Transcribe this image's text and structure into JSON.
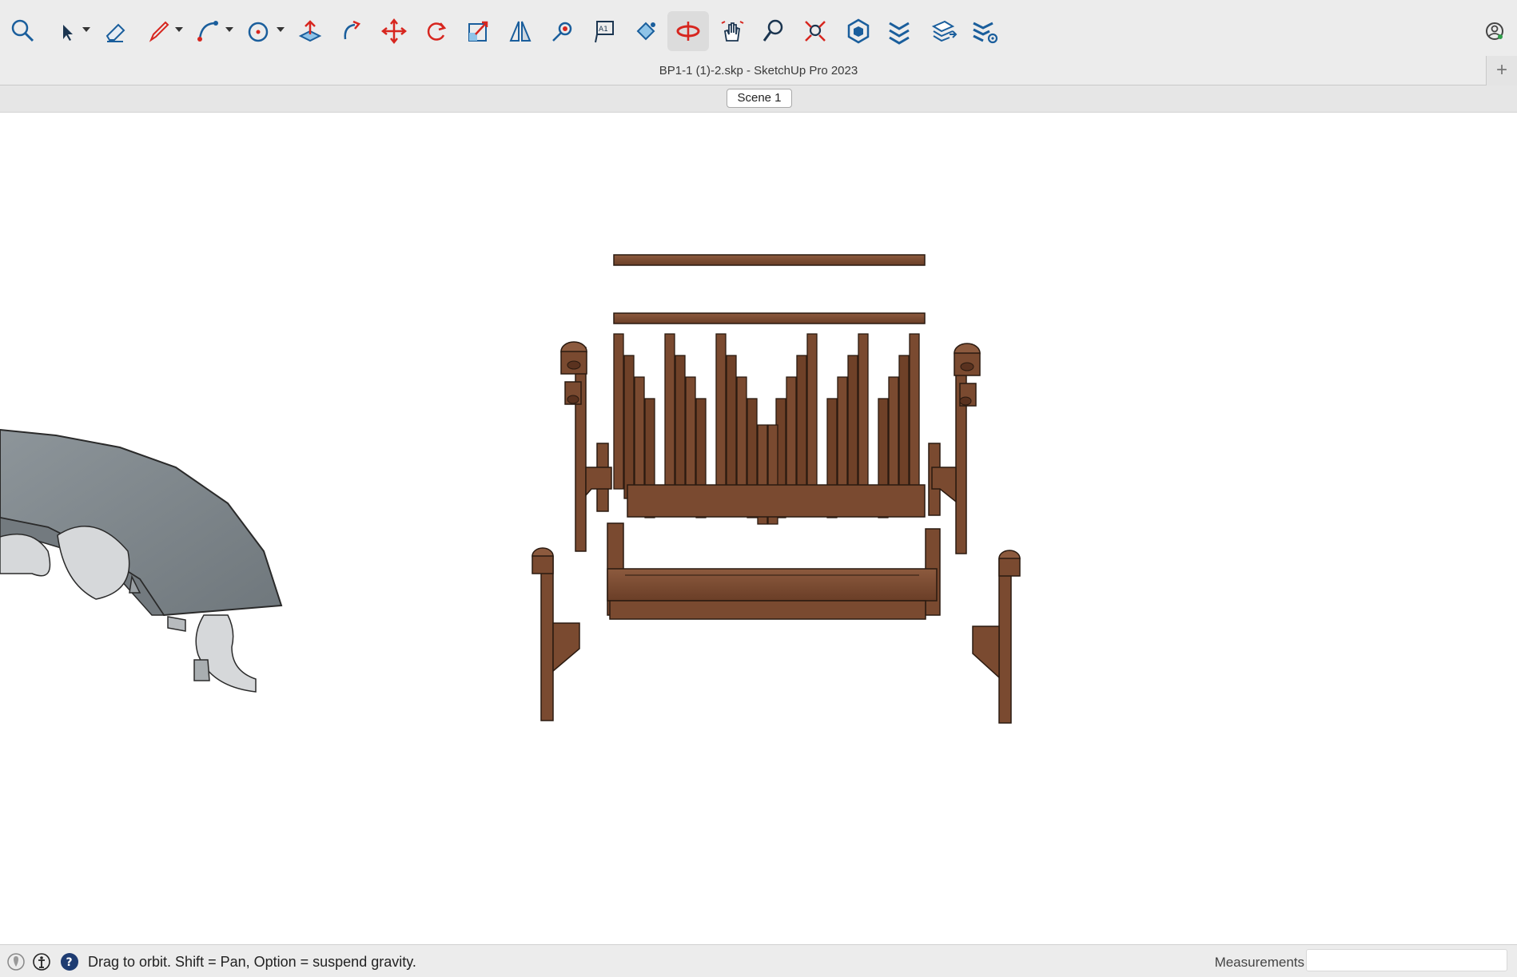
{
  "window": {
    "title": "BP1-1 (1)-2.skp - SketchUp Pro 2023",
    "new_tab_label": "+"
  },
  "scenes": {
    "tabs": [
      {
        "label": "Scene 1"
      }
    ]
  },
  "toolbar": {
    "tools": [
      {
        "name": "search",
        "icon": "search-icon"
      },
      {
        "name": "select",
        "icon": "select-arrow-icon",
        "dropdown": true
      },
      {
        "name": "eraser",
        "icon": "eraser-icon"
      },
      {
        "name": "line",
        "icon": "pencil-icon",
        "dropdown": true
      },
      {
        "name": "arc",
        "icon": "arc-icon",
        "dropdown": true
      },
      {
        "name": "shapes",
        "icon": "circle-icon",
        "dropdown": true
      },
      {
        "name": "push-pull",
        "icon": "push-pull-icon"
      },
      {
        "name": "follow-me",
        "icon": "follow-me-icon"
      },
      {
        "name": "move",
        "icon": "move-icon"
      },
      {
        "name": "rotate",
        "icon": "rotate-icon"
      },
      {
        "name": "scale",
        "icon": "scale-icon"
      },
      {
        "name": "flip",
        "icon": "flip-icon"
      },
      {
        "name": "tape-measure",
        "icon": "tape-measure-icon"
      },
      {
        "name": "text",
        "icon": "text-icon"
      },
      {
        "name": "paint-bucket",
        "icon": "paint-bucket-icon"
      },
      {
        "name": "orbit",
        "icon": "orbit-icon",
        "active": true
      },
      {
        "name": "pan",
        "icon": "pan-hand-icon"
      },
      {
        "name": "zoom",
        "icon": "zoom-icon"
      },
      {
        "name": "zoom-extents",
        "icon": "zoom-extents-icon"
      },
      {
        "name": "warehouse",
        "icon": "warehouse-icon"
      },
      {
        "name": "extension-warehouse",
        "icon": "extension-icon"
      },
      {
        "name": "send-to-layout",
        "icon": "layout-icon"
      },
      {
        "name": "extension-manager",
        "icon": "extension-manager-icon"
      }
    ],
    "account_icon": "account-icon"
  },
  "status": {
    "hint": "Drag to orbit. Shift = Pan, Option = suspend gravity.",
    "icons": [
      "geo-location-icon",
      "credits-icon",
      "help-icon"
    ],
    "measurements_label": "Measurements",
    "measurements_value": ""
  },
  "colors": {
    "wood": "#7a4a30",
    "wood_dark": "#5a321f",
    "wood_light": "#8c5a3e",
    "stone": "#8a9196",
    "stone_light": "#d6d8da",
    "accent_blue": "#1a5e9c",
    "accent_red": "#d7261f"
  }
}
